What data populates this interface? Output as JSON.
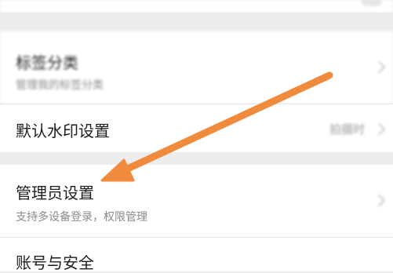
{
  "settings": {
    "tag_category": {
      "title": "标签分类",
      "subtitle": "管理我的标签分类"
    },
    "watermark": {
      "title": "默认水印设置",
      "value": "拍摄时"
    },
    "admin": {
      "title": "管理员设置",
      "subtitle": "支持多设备登录，权限管理"
    },
    "account": {
      "title": "账号与安全"
    }
  },
  "annotation": {
    "arrow_color": "#f08a3c"
  }
}
